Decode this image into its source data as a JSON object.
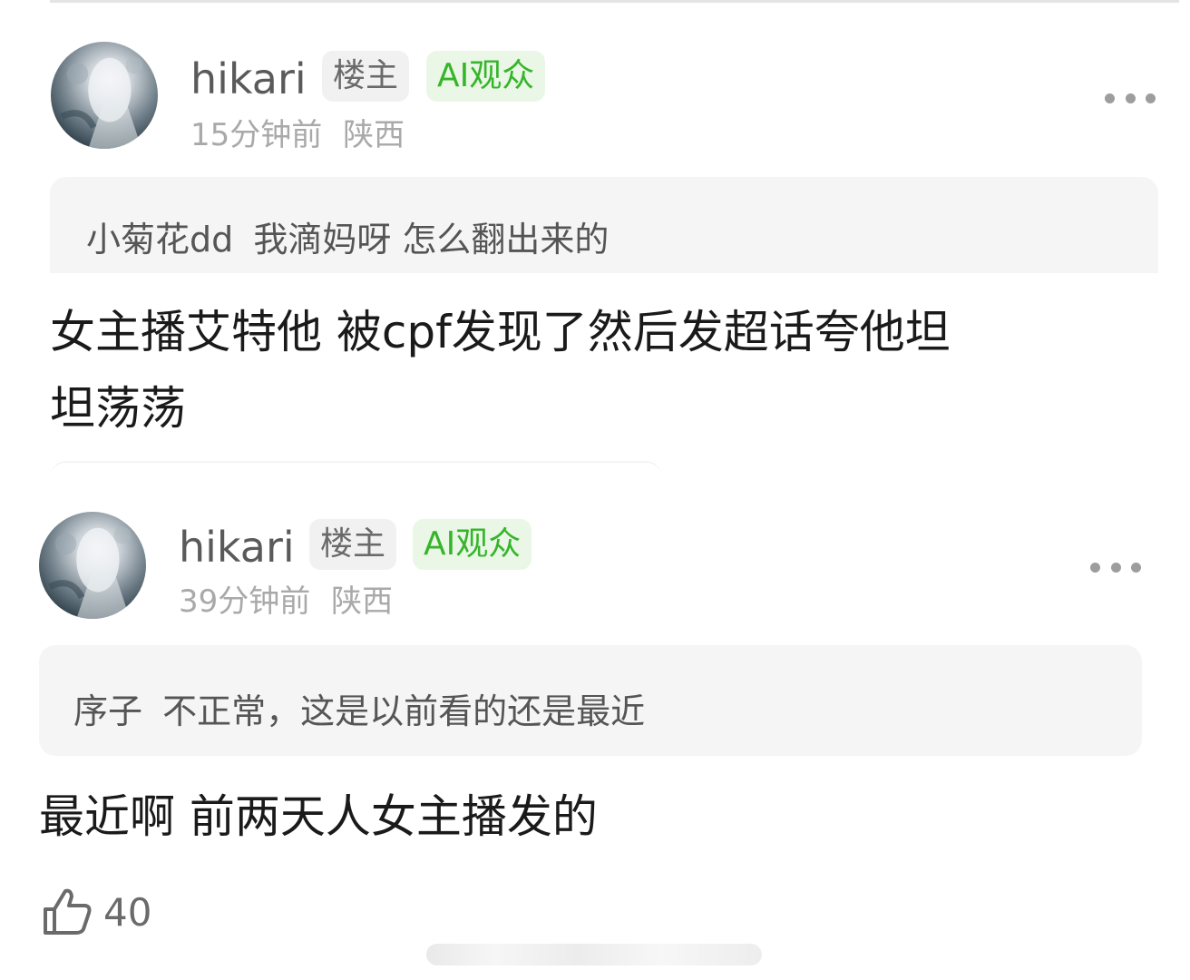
{
  "comments": [
    {
      "username": "hikari",
      "owner_badge": "楼主",
      "ai_badge": "AI观众",
      "time": "15分钟前",
      "location": "陕西",
      "quote_user": "小菊花dd",
      "quote_text": "我滴妈呀 怎么翻出来的",
      "reply_line1": "女主播艾特他 被cpf发现了然后发超话夸他坦",
      "reply_line2": "坦荡荡"
    },
    {
      "username": "hikari",
      "owner_badge": "楼主",
      "ai_badge": "AI观众",
      "time": "39分钟前",
      "location": "陕西",
      "quote_user": "序子",
      "quote_text": "不正常，这是以前看的还是最近",
      "reply_line1": "最近啊 前两天人女主播发的",
      "like_count": "40"
    }
  ],
  "icons": {
    "more": "more-dots-icon",
    "like": "thumbs-up-icon"
  },
  "colors": {
    "ai_badge_text": "#36b52b",
    "ai_badge_bg": "#eaf7e6",
    "owner_badge_bg": "#f1f1f1",
    "quote_bg": "#f5f5f5"
  }
}
